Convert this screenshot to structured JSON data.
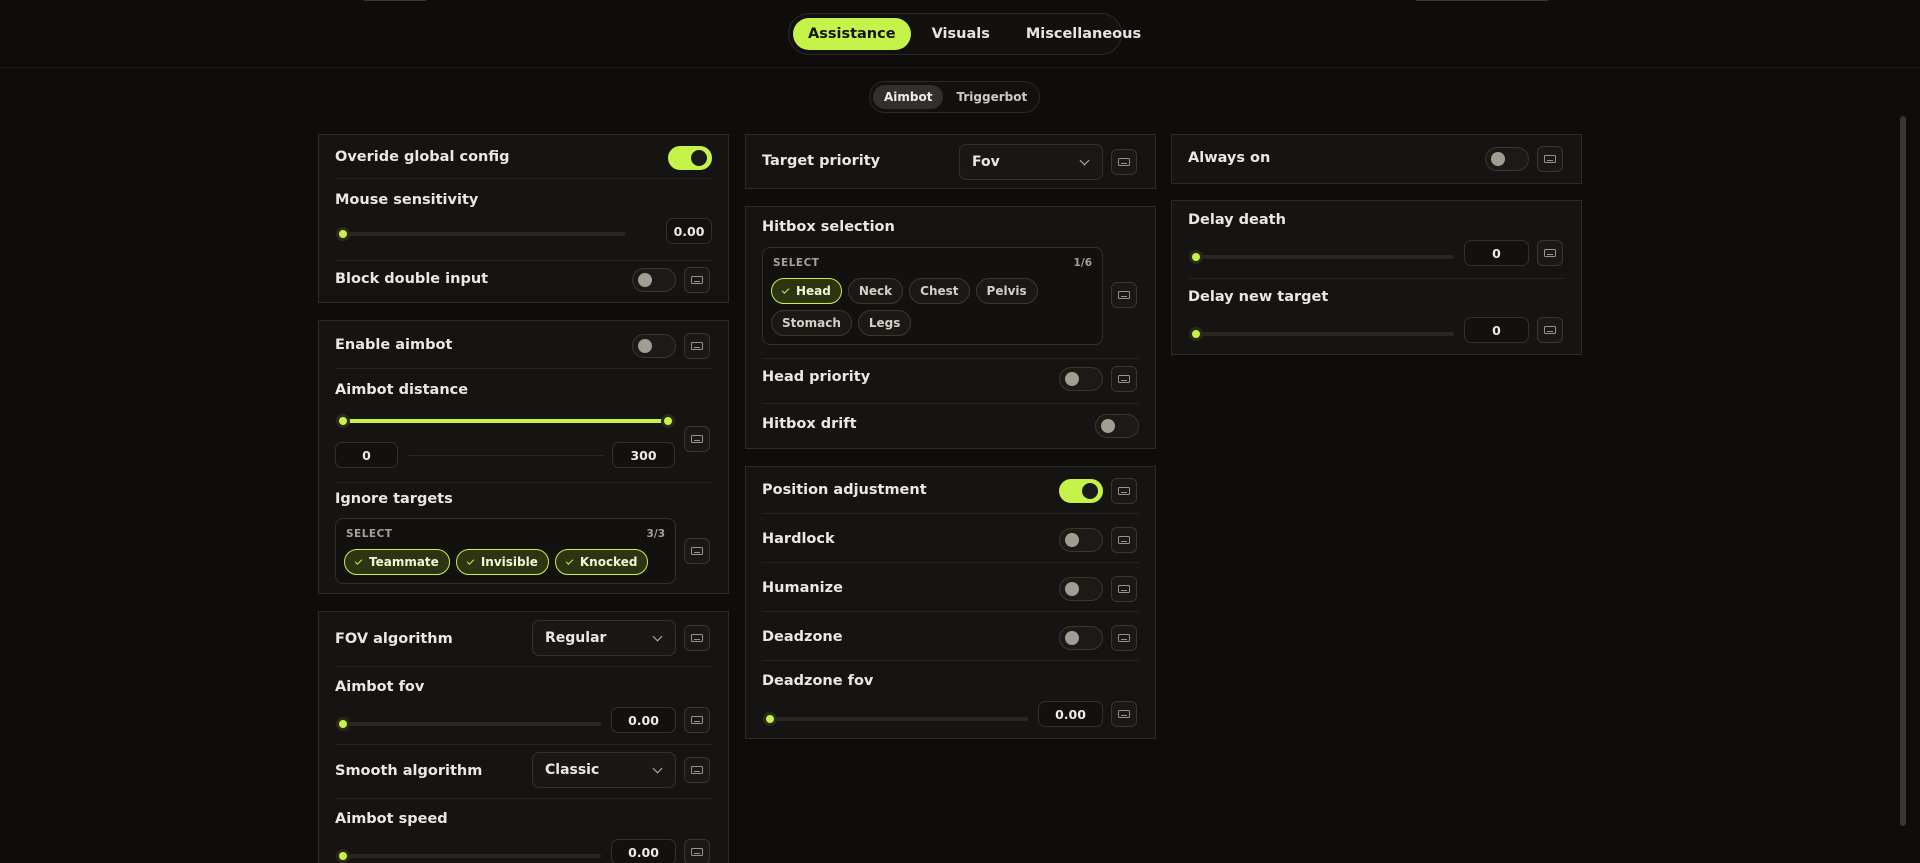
{
  "header": {
    "main_tabs": [
      "Assistance",
      "Visuals",
      "Miscellaneous"
    ],
    "active_main_tab": "Assistance",
    "sub_tabs": [
      "Aimbot",
      "Triggerbot"
    ],
    "active_sub_tab": "Aimbot"
  },
  "colors": {
    "accent": "#c6f34a",
    "background": "#0f0d0b",
    "panel": "#161412"
  },
  "left_column": {
    "general": {
      "override_label": "Overide global config",
      "override_on": true,
      "mouse_sensitivity_label": "Mouse sensitivity",
      "mouse_sensitivity_value": "0.00",
      "block_double_input_label": "Block double input",
      "block_double_input_on": false
    },
    "aimbot": {
      "enable_label": "Enable aimbot",
      "enable_on": false,
      "distance_label": "Aimbot distance",
      "distance_min": "0",
      "distance_max": "300",
      "ignore_label": "Ignore targets",
      "ignore_select_head": "SELECT",
      "ignore_count": "3/3",
      "ignore_options": [
        "Teammate",
        "Invisible",
        "Knocked"
      ]
    },
    "fov": {
      "fov_algorithm_label": "FOV algorithm",
      "fov_algorithm_value": "Regular",
      "aimbot_fov_label": "Aimbot fov",
      "aimbot_fov_value": "0.00",
      "smooth_algorithm_label": "Smooth algorithm",
      "smooth_algorithm_value": "Classic",
      "aimbot_speed_label": "Aimbot speed",
      "aimbot_speed_value": "0.00"
    }
  },
  "middle_column": {
    "target_priority_label": "Target priority",
    "target_priority_value": "Fov",
    "hitbox": {
      "label": "Hitbox selection",
      "select_head": "SELECT",
      "count": "1/6",
      "options": [
        "Head",
        "Neck",
        "Chest",
        "Pelvis",
        "Stomach",
        "Legs"
      ],
      "selected": [
        "Head"
      ],
      "head_priority_label": "Head priority",
      "head_priority_on": false,
      "hitbox_drift_label": "Hitbox drift",
      "hitbox_drift_on": false
    },
    "position": {
      "label": "Position adjustment",
      "position_on": true,
      "hardlock_label": "Hardlock",
      "humanize_label": "Humanize",
      "deadzone_label": "Deadzone",
      "deadzone_fov_label": "Deadzone fov",
      "deadzone_fov_value": "0.00"
    }
  },
  "right_column": {
    "always_on_label": "Always on",
    "always_on": false,
    "delay_death_label": "Delay death",
    "delay_death_value": "0",
    "delay_new_target_label": "Delay new target",
    "delay_new_target_value": "0"
  },
  "icons": [
    "keyboard-icon",
    "chevron-down-icon",
    "check-icon"
  ]
}
